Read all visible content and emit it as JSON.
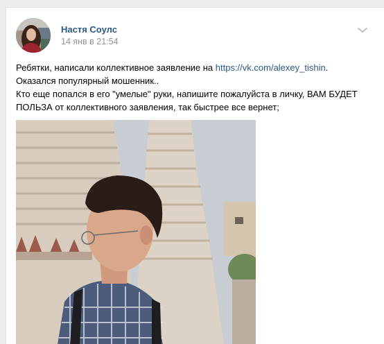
{
  "post": {
    "author": {
      "name": "Настя Соулс"
    },
    "date": "14 янв в 21:54",
    "text": {
      "line1_prefix": "Ребятки, написали коллективное заявление на ",
      "link": "https://vk.com/alexey_tishin",
      "line1_suffix": ".",
      "line2": "Оказался популярный мошенник..",
      "line3": "Кто еще попался в его \"умелые\" руки, напишите пожалуйста в личку, ВАМ БУДЕТ",
      "line4": "ПОЛЬЗА от коллективного заявления, так быстрее все вернет;"
    },
    "menu_icon": "chevron-down-icon",
    "photo_icon": "photo-temple-portrait"
  },
  "colors": {
    "page_bg": "#edeef0",
    "card_bg": "#ffffff",
    "link": "#2a5885",
    "date": "#939393",
    "text": "#000000",
    "chevron": "#b7c0cc"
  }
}
